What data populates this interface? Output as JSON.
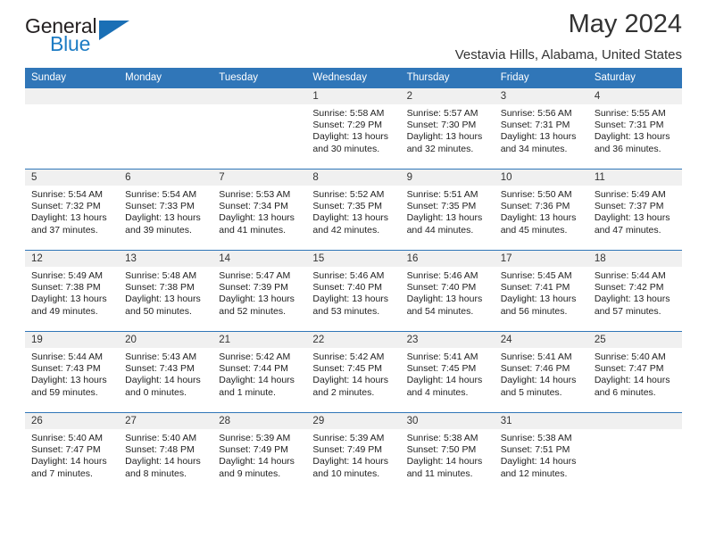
{
  "logo": {
    "part1": "General",
    "part2": "Blue",
    "triangle_color": "#1a6fb5"
  },
  "header": {
    "title": "May 2024",
    "subtitle": "Vestavia Hills, Alabama, United States"
  },
  "colors": {
    "header_blue": "#3076b8",
    "daynum_band": "#f0f0f0",
    "text": "#222222"
  },
  "weekday_headers": [
    "Sunday",
    "Monday",
    "Tuesday",
    "Wednesday",
    "Thursday",
    "Friday",
    "Saturday"
  ],
  "weeks": [
    [
      {
        "day": "",
        "sunrise": "",
        "sunset": "",
        "daylight_line1": "",
        "daylight_line2": "",
        "empty": true
      },
      {
        "day": "",
        "sunrise": "",
        "sunset": "",
        "daylight_line1": "",
        "daylight_line2": "",
        "empty": true
      },
      {
        "day": "",
        "sunrise": "",
        "sunset": "",
        "daylight_line1": "",
        "daylight_line2": "",
        "empty": true
      },
      {
        "day": "1",
        "sunrise": "Sunrise: 5:58 AM",
        "sunset": "Sunset: 7:29 PM",
        "daylight_line1": "Daylight: 13 hours",
        "daylight_line2": "and 30 minutes."
      },
      {
        "day": "2",
        "sunrise": "Sunrise: 5:57 AM",
        "sunset": "Sunset: 7:30 PM",
        "daylight_line1": "Daylight: 13 hours",
        "daylight_line2": "and 32 minutes."
      },
      {
        "day": "3",
        "sunrise": "Sunrise: 5:56 AM",
        "sunset": "Sunset: 7:31 PM",
        "daylight_line1": "Daylight: 13 hours",
        "daylight_line2": "and 34 minutes."
      },
      {
        "day": "4",
        "sunrise": "Sunrise: 5:55 AM",
        "sunset": "Sunset: 7:31 PM",
        "daylight_line1": "Daylight: 13 hours",
        "daylight_line2": "and 36 minutes."
      }
    ],
    [
      {
        "day": "5",
        "sunrise": "Sunrise: 5:54 AM",
        "sunset": "Sunset: 7:32 PM",
        "daylight_line1": "Daylight: 13 hours",
        "daylight_line2": "and 37 minutes."
      },
      {
        "day": "6",
        "sunrise": "Sunrise: 5:54 AM",
        "sunset": "Sunset: 7:33 PM",
        "daylight_line1": "Daylight: 13 hours",
        "daylight_line2": "and 39 minutes."
      },
      {
        "day": "7",
        "sunrise": "Sunrise: 5:53 AM",
        "sunset": "Sunset: 7:34 PM",
        "daylight_line1": "Daylight: 13 hours",
        "daylight_line2": "and 41 minutes."
      },
      {
        "day": "8",
        "sunrise": "Sunrise: 5:52 AM",
        "sunset": "Sunset: 7:35 PM",
        "daylight_line1": "Daylight: 13 hours",
        "daylight_line2": "and 42 minutes."
      },
      {
        "day": "9",
        "sunrise": "Sunrise: 5:51 AM",
        "sunset": "Sunset: 7:35 PM",
        "daylight_line1": "Daylight: 13 hours",
        "daylight_line2": "and 44 minutes."
      },
      {
        "day": "10",
        "sunrise": "Sunrise: 5:50 AM",
        "sunset": "Sunset: 7:36 PM",
        "daylight_line1": "Daylight: 13 hours",
        "daylight_line2": "and 45 minutes."
      },
      {
        "day": "11",
        "sunrise": "Sunrise: 5:49 AM",
        "sunset": "Sunset: 7:37 PM",
        "daylight_line1": "Daylight: 13 hours",
        "daylight_line2": "and 47 minutes."
      }
    ],
    [
      {
        "day": "12",
        "sunrise": "Sunrise: 5:49 AM",
        "sunset": "Sunset: 7:38 PM",
        "daylight_line1": "Daylight: 13 hours",
        "daylight_line2": "and 49 minutes."
      },
      {
        "day": "13",
        "sunrise": "Sunrise: 5:48 AM",
        "sunset": "Sunset: 7:38 PM",
        "daylight_line1": "Daylight: 13 hours",
        "daylight_line2": "and 50 minutes."
      },
      {
        "day": "14",
        "sunrise": "Sunrise: 5:47 AM",
        "sunset": "Sunset: 7:39 PM",
        "daylight_line1": "Daylight: 13 hours",
        "daylight_line2": "and 52 minutes."
      },
      {
        "day": "15",
        "sunrise": "Sunrise: 5:46 AM",
        "sunset": "Sunset: 7:40 PM",
        "daylight_line1": "Daylight: 13 hours",
        "daylight_line2": "and 53 minutes."
      },
      {
        "day": "16",
        "sunrise": "Sunrise: 5:46 AM",
        "sunset": "Sunset: 7:40 PM",
        "daylight_line1": "Daylight: 13 hours",
        "daylight_line2": "and 54 minutes."
      },
      {
        "day": "17",
        "sunrise": "Sunrise: 5:45 AM",
        "sunset": "Sunset: 7:41 PM",
        "daylight_line1": "Daylight: 13 hours",
        "daylight_line2": "and 56 minutes."
      },
      {
        "day": "18",
        "sunrise": "Sunrise: 5:44 AM",
        "sunset": "Sunset: 7:42 PM",
        "daylight_line1": "Daylight: 13 hours",
        "daylight_line2": "and 57 minutes."
      }
    ],
    [
      {
        "day": "19",
        "sunrise": "Sunrise: 5:44 AM",
        "sunset": "Sunset: 7:43 PM",
        "daylight_line1": "Daylight: 13 hours",
        "daylight_line2": "and 59 minutes."
      },
      {
        "day": "20",
        "sunrise": "Sunrise: 5:43 AM",
        "sunset": "Sunset: 7:43 PM",
        "daylight_line1": "Daylight: 14 hours",
        "daylight_line2": "and 0 minutes."
      },
      {
        "day": "21",
        "sunrise": "Sunrise: 5:42 AM",
        "sunset": "Sunset: 7:44 PM",
        "daylight_line1": "Daylight: 14 hours",
        "daylight_line2": "and 1 minute."
      },
      {
        "day": "22",
        "sunrise": "Sunrise: 5:42 AM",
        "sunset": "Sunset: 7:45 PM",
        "daylight_line1": "Daylight: 14 hours",
        "daylight_line2": "and 2 minutes."
      },
      {
        "day": "23",
        "sunrise": "Sunrise: 5:41 AM",
        "sunset": "Sunset: 7:45 PM",
        "daylight_line1": "Daylight: 14 hours",
        "daylight_line2": "and 4 minutes."
      },
      {
        "day": "24",
        "sunrise": "Sunrise: 5:41 AM",
        "sunset": "Sunset: 7:46 PM",
        "daylight_line1": "Daylight: 14 hours",
        "daylight_line2": "and 5 minutes."
      },
      {
        "day": "25",
        "sunrise": "Sunrise: 5:40 AM",
        "sunset": "Sunset: 7:47 PM",
        "daylight_line1": "Daylight: 14 hours",
        "daylight_line2": "and 6 minutes."
      }
    ],
    [
      {
        "day": "26",
        "sunrise": "Sunrise: 5:40 AM",
        "sunset": "Sunset: 7:47 PM",
        "daylight_line1": "Daylight: 14 hours",
        "daylight_line2": "and 7 minutes."
      },
      {
        "day": "27",
        "sunrise": "Sunrise: 5:40 AM",
        "sunset": "Sunset: 7:48 PM",
        "daylight_line1": "Daylight: 14 hours",
        "daylight_line2": "and 8 minutes."
      },
      {
        "day": "28",
        "sunrise": "Sunrise: 5:39 AM",
        "sunset": "Sunset: 7:49 PM",
        "daylight_line1": "Daylight: 14 hours",
        "daylight_line2": "and 9 minutes."
      },
      {
        "day": "29",
        "sunrise": "Sunrise: 5:39 AM",
        "sunset": "Sunset: 7:49 PM",
        "daylight_line1": "Daylight: 14 hours",
        "daylight_line2": "and 10 minutes."
      },
      {
        "day": "30",
        "sunrise": "Sunrise: 5:38 AM",
        "sunset": "Sunset: 7:50 PM",
        "daylight_line1": "Daylight: 14 hours",
        "daylight_line2": "and 11 minutes."
      },
      {
        "day": "31",
        "sunrise": "Sunrise: 5:38 AM",
        "sunset": "Sunset: 7:51 PM",
        "daylight_line1": "Daylight: 14 hours",
        "daylight_line2": "and 12 minutes."
      },
      {
        "day": "",
        "sunrise": "",
        "sunset": "",
        "daylight_line1": "",
        "daylight_line2": "",
        "empty": true
      }
    ]
  ]
}
